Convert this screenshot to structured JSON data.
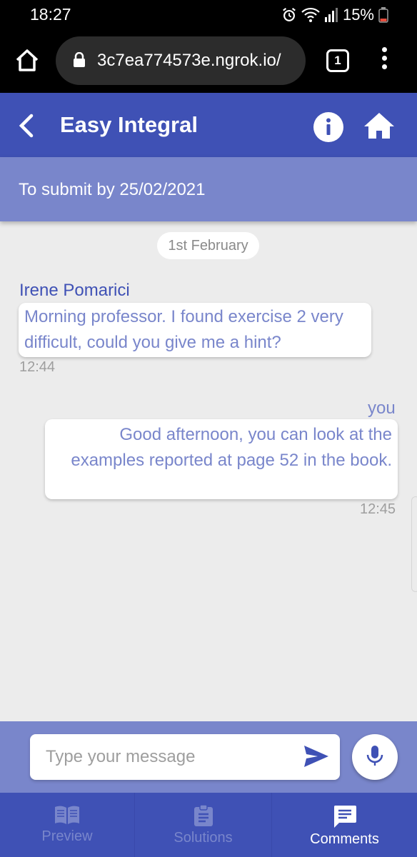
{
  "status_bar": {
    "time": "18:27",
    "battery": "15%"
  },
  "browser": {
    "url": "3c7ea774573e.ngrok.io/",
    "tab_count": "1"
  },
  "app_bar": {
    "title": "Easy Integral"
  },
  "deadline": {
    "text": "To submit by 25/02/2021"
  },
  "chat": {
    "date_chip": "1st February",
    "messages": [
      {
        "sender": "Irene Pomarici",
        "text": "Morning professor. I found exercise 2 very difficult, could you give me a hint?",
        "time": "12:44"
      },
      {
        "sender": "you",
        "text": "Good afternoon, you can look at the examples reported at page 52 in the book.",
        "time": "12:45"
      }
    ]
  },
  "composer": {
    "placeholder": "Type your message"
  },
  "bottom_nav": {
    "tabs": [
      {
        "label": "Preview",
        "icon": "book-icon",
        "active": false
      },
      {
        "label": "Solutions",
        "icon": "clipboard-icon",
        "active": false
      },
      {
        "label": "Comments",
        "icon": "comment-icon",
        "active": true
      }
    ]
  },
  "colors": {
    "primary": "#3f51b5",
    "secondary": "#7986cb",
    "background": "#ececec"
  }
}
